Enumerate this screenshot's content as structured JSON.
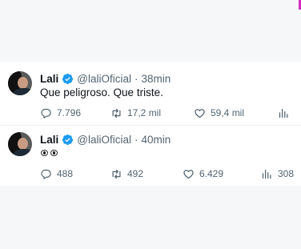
{
  "tweets": [
    {
      "name": "Lali",
      "handle": "@laliOficial",
      "time": "38min",
      "text": "Que peligroso. Que triste.",
      "replies": "7.796",
      "retweets": "17,2 mil",
      "likes": "59,4 mil",
      "views": ""
    },
    {
      "name": "Lali",
      "handle": "@laliOficial",
      "time": "40min",
      "text": "👀",
      "replies": "488",
      "retweets": "492",
      "likes": "6.429",
      "views": "308"
    }
  ],
  "colors": {
    "verified": "#1d9bf0",
    "secondary_text": "#536471",
    "primary_text": "#0f1419"
  },
  "icons": [
    "verified-badge-icon",
    "reply-icon",
    "retweet-icon",
    "like-icon",
    "views-icon"
  ]
}
